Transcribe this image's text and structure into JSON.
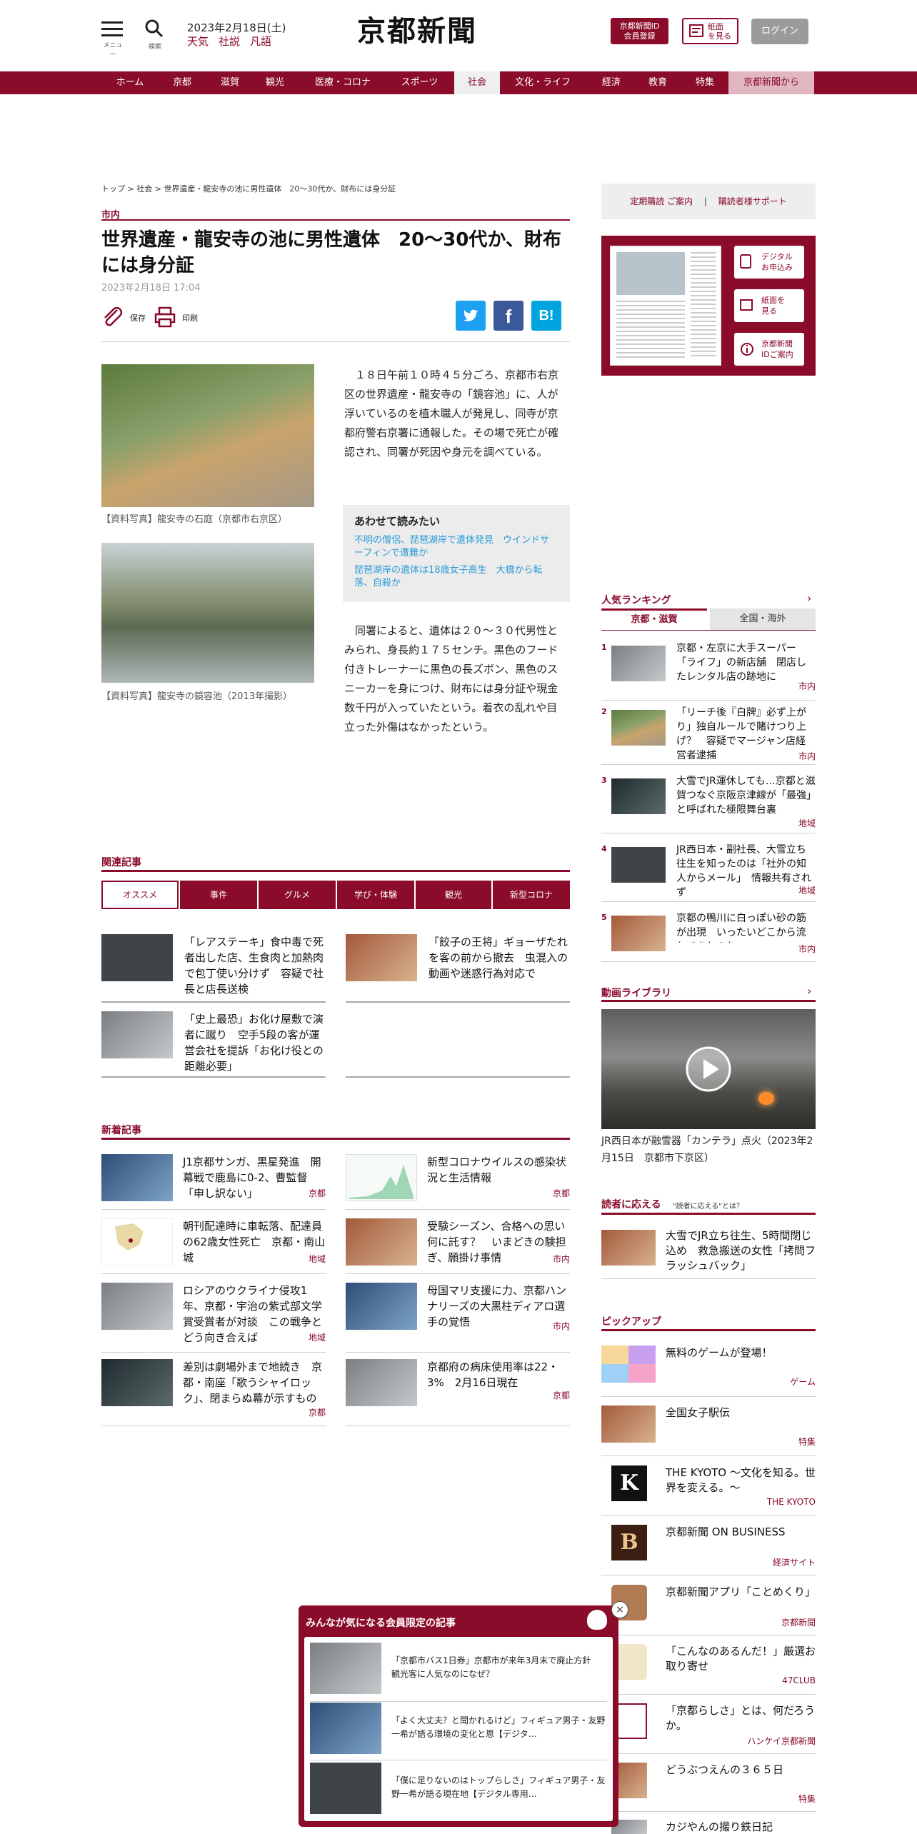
{
  "header": {
    "menu_label": "メニュー",
    "search_label": "検索",
    "date": "2023年2月18日(土)",
    "links": [
      "天気",
      "社説",
      "凡語"
    ],
    "logo": "京都新聞",
    "register_btn": [
      "京都新聞ID",
      "会員登録"
    ],
    "paper_btn": [
      "紙面",
      "を見る"
    ],
    "login_btn": "ログイン"
  },
  "nav": {
    "items": [
      "ホーム",
      "京都",
      "滋賀",
      "観光",
      "医療・コロナ",
      "スポーツ",
      "社会",
      "文化・ライフ",
      "経済",
      "教育",
      "特集",
      "京都新聞から"
    ],
    "active": "社会"
  },
  "breadcrumb": [
    "トップ",
    "社会",
    "世界遺産・龍安寺の池に男性遺体　20～30代か、財布には身分証"
  ],
  "article": {
    "category": "市内",
    "title": "世界遺産・龍安寺の池に男性遺体　20～30代か、財布には身分証",
    "date": "2023年2月18日 17:04",
    "save_label": "保存",
    "print_label": "印刷",
    "share": [
      "twitter-icon",
      "facebook-icon",
      "hatena-icon"
    ],
    "photo1_caption": "【資料写真】龍安寺の石庭（京都市右京区）",
    "photo2_caption": "【資料写真】龍安寺の鏡容池（2013年撮影）",
    "para1": "１８日午前１０時４５分ごろ、京都市右京区の世界遺産・龍安寺の「鏡容池」に、人が浮いているのを植木職人が発見し、同寺が京都府警右京署に通報した。その場で死亡が確認され、同署が死因や身元を調べている。",
    "para2": "同署によると、遺体は２０～３０代男性とみられ、身長約１７５センチ。黒色のフード付きトレーナーに黒色の長ズボン、黒色のスニーカーを身につけ、財布には身分証や現金数千円が入っていたという。着衣の乱れや目立った外傷はなかったという。",
    "recommend_title": "あわせて読みたい",
    "recommend_links": [
      "不明の僧侶、琵琶湖岸で遺体発見　ウインドサーフィンで遭難か",
      "琵琶湖岸の遺体は18歳女子高生　大橋から転落、自殺か"
    ]
  },
  "related": {
    "title": "関連記事",
    "tabs": [
      "オススメ",
      "事件",
      "グルメ",
      "学び・体験",
      "観光",
      "新型コロナ"
    ],
    "items": [
      "「レアステーキ」食中毒で死者出した店、生食肉と加熱肉で包丁使い分けず　容疑で社長と店長送検",
      "「餃子の王将」ギョーザたれを客の前から撤去　虫混入の動画や迷惑行為対応で",
      "「史上最恐」お化け屋敷で演者に蹴り　空手5段の客が運営会社を提訴「お化け役との距離必要」"
    ]
  },
  "latest": {
    "title": "新着記事",
    "items": [
      {
        "text": "J1京都サンガ、黒星発進　開幕戦で鹿島に0-2、曹監督「申し訳ない」",
        "tag": "京都"
      },
      {
        "text": "新型コロナウイルスの感染状況と生活情報",
        "tag": "京都"
      },
      {
        "text": "朝刊配達時に車転落、配達員の62歳女性死亡　京都・南山城",
        "tag": "地域"
      },
      {
        "text": "受験シーズン、合格への思い何に託す？　いまどきの験担ぎ、願掛け事情",
        "tag": "市内"
      },
      {
        "text": "ロシアのウクライナ侵攻1年、京都・宇治の紫式部文学賞受賞者が対談　この戦争とどう向き合えば",
        "tag": "地域"
      },
      {
        "text": "母国マリ支援に力、京都ハンナリーズの大黒柱ディアロ選手の覚悟",
        "tag": "市内"
      },
      {
        "text": "差別は劇場外まで地続き　京都・南座「歌うシャイロック」、閉まらぬ幕が示すもの",
        "tag": "京都"
      },
      {
        "text": "京都府の病床使用率は22・3%　2月16日現在",
        "tag": "京都"
      }
    ]
  },
  "sidebar": {
    "subscribe": "定期購読 ご案内",
    "support": "購読者様サポート",
    "digital_btn": [
      "デジタル",
      "お申込み"
    ],
    "paper_btn": [
      "紙面を",
      "見る"
    ],
    "id_btn": [
      "京都新聞",
      "IDご案内"
    ],
    "ranking_title": "人気ランキング",
    "ranking_tabs": [
      "京都・滋賀",
      "全国・海外"
    ],
    "ranking": [
      {
        "num": "1",
        "text": "京都・左京に大手スーパー「ライフ」の新店舗　閉店したレンタル店の跡地に",
        "tag": "市内"
      },
      {
        "num": "2",
        "text": "「リーチ後『白牌』必ず上がり」独自ルールで賭けつり上げ？　容疑でマージャン店経営者逮捕",
        "tag": "市内"
      },
      {
        "num": "3",
        "text": "大雪でJR運休しても…京都と滋賀つなぐ京阪京津線が「最強」と呼ばれた極限舞台裏",
        "tag": "地域"
      },
      {
        "num": "4",
        "text": "JR西日本・副社長、大雪立ち往生を知ったのは「社外の知人からメール」　情報共有されず",
        "tag": "地域"
      },
      {
        "num": "5",
        "text": "京都の鴨川に白っぽい砂の筋が出現　いったいどこから流れてきたのか",
        "tag": "市内"
      }
    ],
    "video_title": "動画ライブラリ",
    "video_caption": "JR西日本が融雪器「カンテラ」点火（2023年2月15日　京都市下京区）",
    "reader_title": "読者に応える",
    "reader_sub": "\"読者に応える\"とは？",
    "reader_text": "大雪でJR立ち往生、5時間閉じ込め　救急搬送の女性「拷問フラッシュバック」",
    "pickup_title": "ピックアップ",
    "pickup": [
      {
        "text": "無料のゲームが登場！",
        "tag": "ゲーム"
      },
      {
        "text": "全国女子駅伝",
        "tag": "特集"
      },
      {
        "text": "THE KYOTO ～文化を知る。世界を変える。～",
        "tag": "THE KYOTO"
      },
      {
        "text": "京都新聞 ON BUSINESS",
        "tag": "経済サイト"
      },
      {
        "text": "京都新聞アプリ「ことめくり」",
        "tag": "京都新聞"
      },
      {
        "text": "「こんなのあるんだ！」厳選お取り寄せ",
        "tag": "47CLUB"
      },
      {
        "text": "「京都らしさ」とは、何だろうか。",
        "tag": "ハンケイ京都新聞"
      },
      {
        "text": "どうぶつえんの３６５日",
        "tag": "特集"
      },
      {
        "text": "カジやんの撮り鉄日記",
        "tag": ""
      }
    ]
  },
  "popup": {
    "title": "みんなが気になる会員限定の記事",
    "items": [
      "「京都市バス1日券」京都市が来年3月末で廃止方針　観光客に人気なのになぜ？",
      "「よく大丈夫？と聞かれるけど」フィギュア男子・友野一希が語る環境の変化と恩【デジタ…",
      "「僕に足りないのはトップらしさ」フィギュア男子・友野一希が語る現在地【デジタル専用…"
    ]
  },
  "colors": {
    "brand": "#8a0b2a",
    "link": "#2a9bd8",
    "twitter": "#1da1f2",
    "facebook": "#3b5998",
    "hatena": "#00a4de"
  }
}
